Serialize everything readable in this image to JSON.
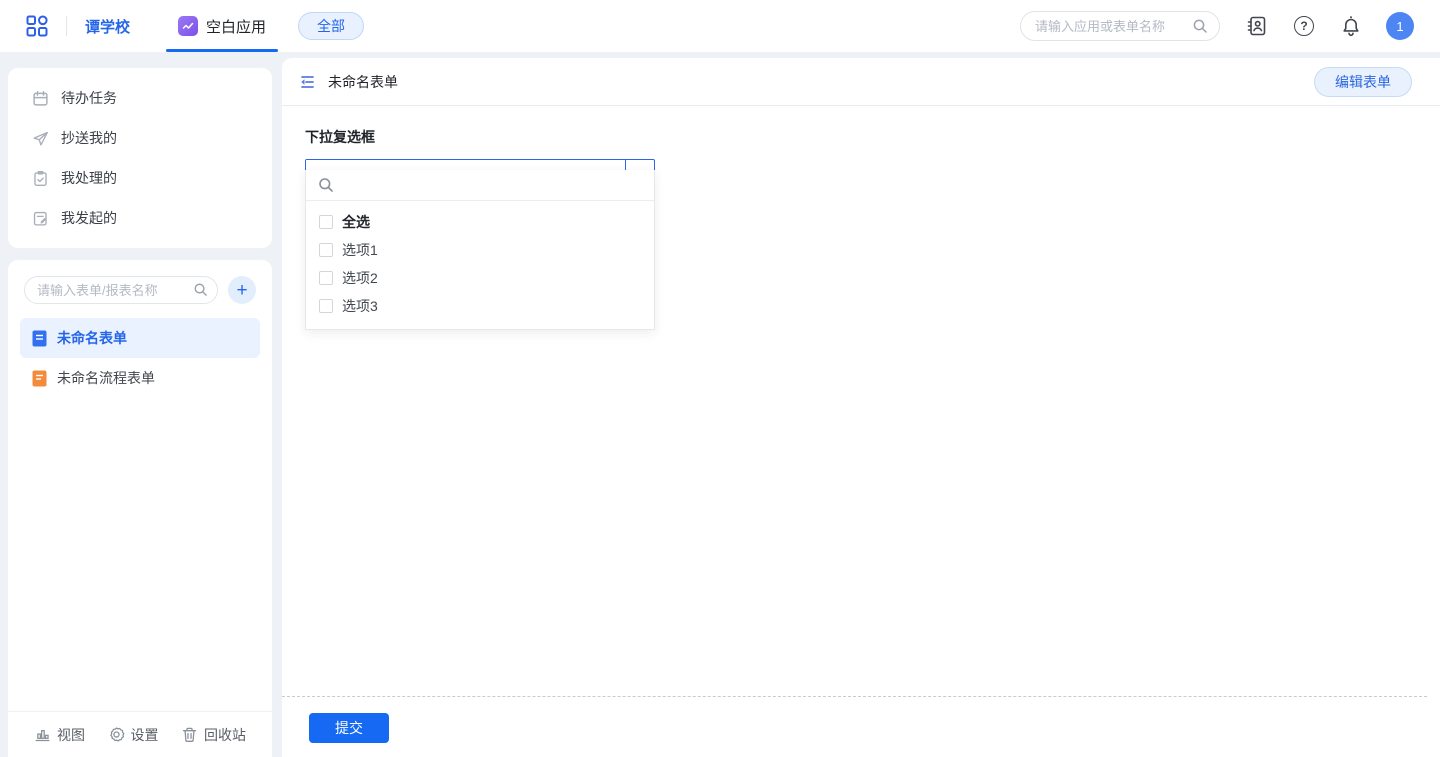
{
  "topbar": {
    "workspace": "谭学校",
    "tab_label": "空白应用",
    "filter_pill": "全部",
    "search_placeholder": "请输入应用或表单名称",
    "avatar": "1",
    "help_glyph": "?"
  },
  "sidebar": {
    "tasks": [
      {
        "label": "待办任务",
        "icon": "calendar-icon"
      },
      {
        "label": "抄送我的",
        "icon": "send-icon"
      },
      {
        "label": "我处理的",
        "icon": "clipboard-check-icon"
      },
      {
        "label": "我发起的",
        "icon": "doc-edit-icon"
      }
    ],
    "search_placeholder": "请输入表单/报表名称",
    "add_glyph": "+",
    "forms": [
      {
        "label": "未命名表单",
        "selected": true,
        "icon_color": "#3370F0"
      },
      {
        "label": "未命名流程表单",
        "selected": false,
        "icon_color": "#F28B3B"
      }
    ],
    "footer": [
      {
        "label": "视图",
        "icon": "bar-chart-icon"
      },
      {
        "label": "设置",
        "icon": "gear-icon"
      },
      {
        "label": "回收站",
        "icon": "trash-icon"
      }
    ]
  },
  "main": {
    "title": "未命名表单",
    "edit_button": "编辑表单",
    "field": {
      "label": "下拉复选框",
      "value": "",
      "options": [
        {
          "label": "全选",
          "checked": false
        },
        {
          "label": "选项1",
          "checked": false
        },
        {
          "label": "选项2",
          "checked": false
        },
        {
          "label": "选项3",
          "checked": false
        }
      ]
    },
    "submit_button": "提交"
  },
  "colors": {
    "primary": "#1569F2",
    "accent_text": "#2566E8",
    "selected_item_bg": "#E9F2FE",
    "flow_form_icon": "#F28B3B",
    "app_icon_purple": "#8A63E8"
  }
}
